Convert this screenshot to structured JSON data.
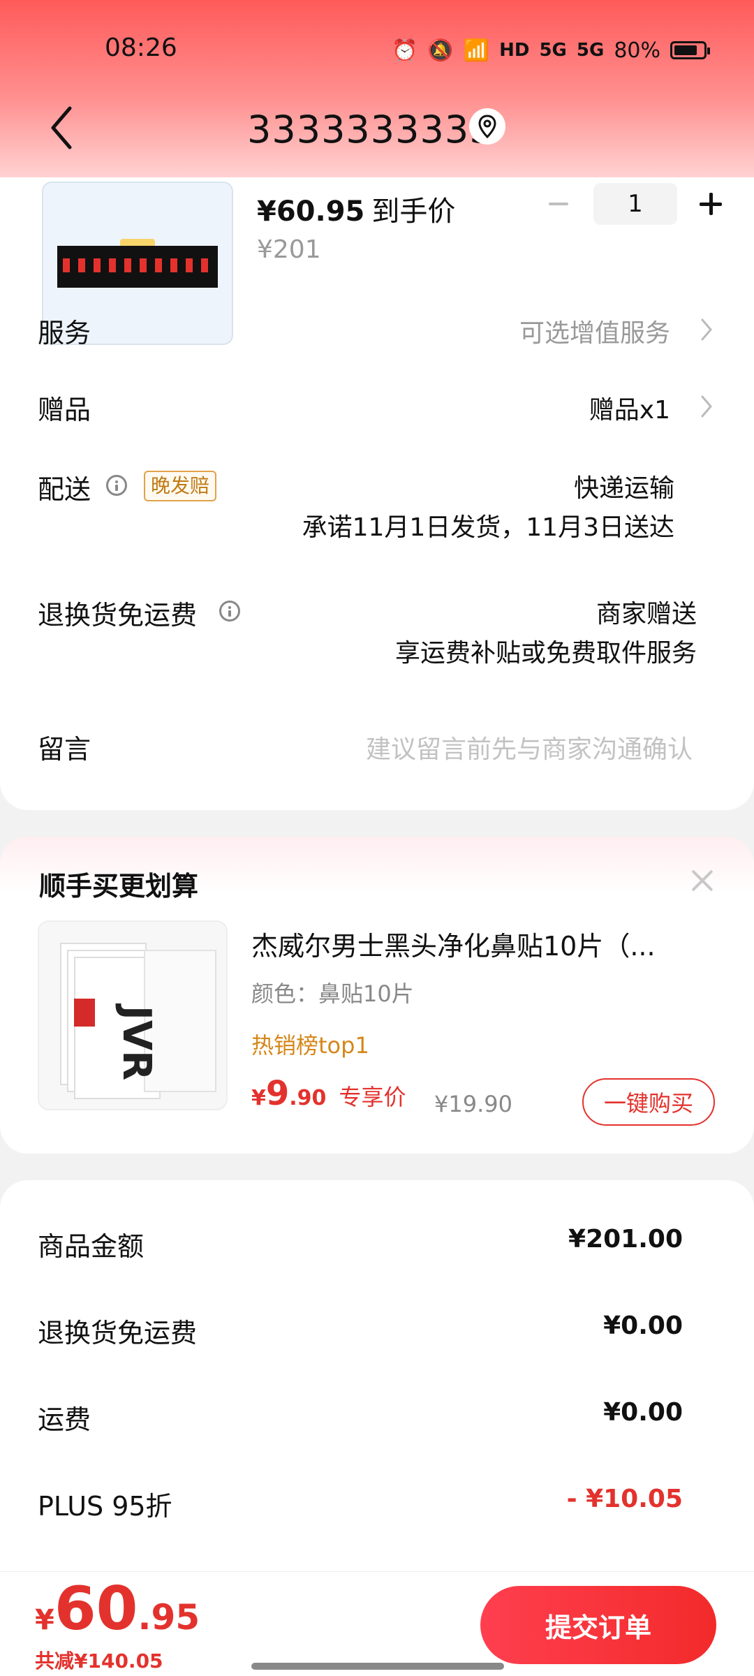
{
  "status": {
    "time": "08:26",
    "net_hd": "HD",
    "signal1": "5G",
    "signal2": "5G",
    "battery": "80%",
    "battery_level": 0.8
  },
  "header": {
    "title": "3333333333"
  },
  "product": {
    "price": "¥60.95",
    "price_suffix": "到手价",
    "original_price": "¥201",
    "quantity": "1"
  },
  "rows": {
    "service": {
      "label": "服务",
      "value": "可选增值服务"
    },
    "gift": {
      "label": "赠品",
      "value": "赠品x1"
    },
    "delivery": {
      "label": "配送",
      "badge": "晚发赔",
      "line1": "快递运输",
      "line2": "承诺11月1日发货，11月3日送达"
    },
    "return": {
      "label": "退换货免运费",
      "line1": "商家赠送",
      "line2": "享运费补贴或免费取件服务"
    },
    "message": {
      "label": "留言",
      "placeholder": "建议留言前先与商家沟通确认"
    }
  },
  "upsell": {
    "title": "顺手买更划算",
    "name": "杰威尔男士黑头净化鼻贴10片（...",
    "spec": "颜色：鼻贴10片",
    "hot": "热销榜top1",
    "price_cur": "¥",
    "price_int": "9",
    "price_dec": ".90",
    "price_tag": "专享价",
    "orig_price": "¥19.90",
    "buy": "一键购买",
    "brand_text": "JVR"
  },
  "summary": [
    {
      "label": "商品金额",
      "value": "¥201.00",
      "color": "#111111"
    },
    {
      "label": "退换货免运费",
      "value": "¥0.00",
      "color": "#111111"
    },
    {
      "label": "运费",
      "value": "¥0.00",
      "color": "#111111"
    },
    {
      "label": "PLUS 95折",
      "value": "- ¥10.05",
      "color": "#e3322d"
    }
  ],
  "bottom": {
    "cur": "¥",
    "int": "60",
    "dec": ".95",
    "saved": "共减¥140.05",
    "submit": "提交订单"
  },
  "colors": {
    "accent": "#e3322d",
    "header_top": "#ff5a5a"
  }
}
